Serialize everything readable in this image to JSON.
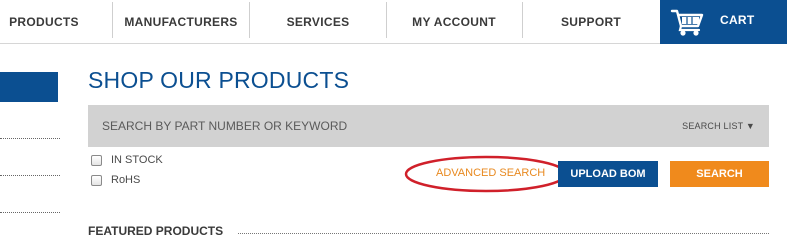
{
  "nav": {
    "items": [
      {
        "label": "PRODUCTS"
      },
      {
        "label": "MANUFACTURERS"
      },
      {
        "label": "SERVICES"
      },
      {
        "label": "MY ACCOUNT"
      },
      {
        "label": "SUPPORT"
      }
    ],
    "cart_label": "CART",
    "cart_icon": "shopping-cart-icon"
  },
  "main": {
    "title": "SHOP OUR PRODUCTS",
    "search": {
      "placeholder": "SEARCH BY PART NUMBER OR KEYWORD",
      "value": "",
      "search_list_label": "SEARCH LIST ▼"
    },
    "filters": [
      {
        "label": "IN STOCK",
        "checked": false
      },
      {
        "label": "RoHS",
        "checked": false
      }
    ],
    "advanced_search_label": "ADVANCED SEARCH",
    "upload_bom_label": "UPLOAD BOM",
    "search_button_label": "SEARCH",
    "featured_heading": "FEATURED PRODUCTS"
  },
  "colors": {
    "brand_blue": "#0b4f91",
    "accent_orange": "#f08a1c",
    "highlight_red": "#d0202a"
  }
}
